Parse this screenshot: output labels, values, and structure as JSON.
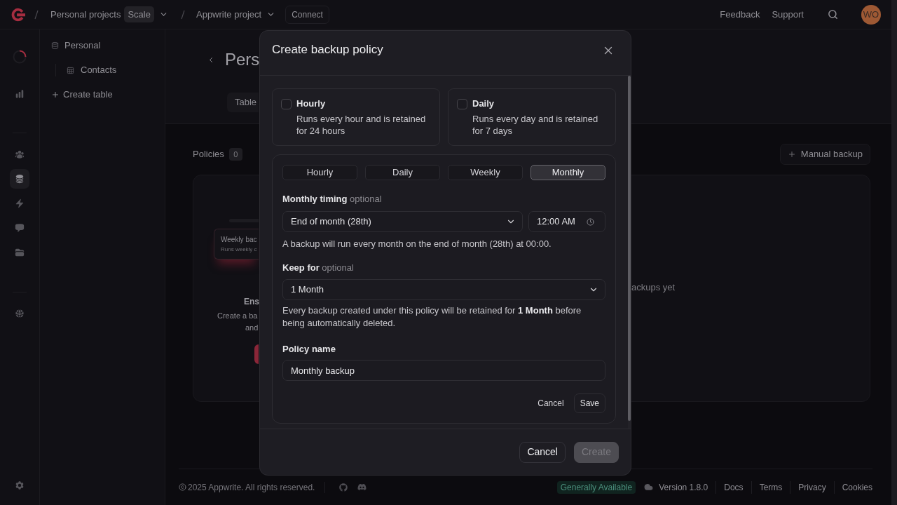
{
  "top_bar": {
    "breadcrumbs": [
      {
        "label": "Personal projects",
        "badge": "Scale"
      },
      {
        "label": "Appwrite project"
      }
    ],
    "connect_button": "Connect",
    "links": [
      "Feedback",
      "Support"
    ],
    "avatar_initials": "WO"
  },
  "nav_rail": {
    "items": [
      {
        "selected": false
      },
      {
        "selected": false
      },
      {
        "selected": true
      },
      {
        "selected": false
      },
      {
        "selected": false
      },
      {
        "selected": false
      },
      {
        "selected": false
      }
    ]
  },
  "database_sidebar": {
    "database": "Personal",
    "tables": [
      {
        "label": "Contacts"
      }
    ],
    "create_button": "Create table"
  },
  "page_header": {
    "title": "Pers",
    "tabs": [
      {
        "label": "Table"
      }
    ]
  },
  "backups": {
    "policies_label": "Policies",
    "policies_count": "0",
    "manual_backup_button": "Manual backup",
    "policies_empty": {
      "preview_title": "Weekly bac",
      "preview_subtitle": "Runs weekly c",
      "heading": "Ens",
      "description_lines": [
        "Create a ba",
        "and"
      ]
    },
    "backups_empty_text": "ackups yet"
  },
  "dialog": {
    "title": "Create backup policy",
    "presets": [
      {
        "title": "Hourly",
        "description": "Runs every hour and is retained for 24 hours",
        "checked": false
      },
      {
        "title": "Daily",
        "description": "Runs every day and is retained for 7 days",
        "checked": false
      }
    ],
    "custom_policy": {
      "frequencies": [
        {
          "label": "Hourly",
          "selected": false
        },
        {
          "label": "Daily",
          "selected": false
        },
        {
          "label": "Weekly",
          "selected": false
        },
        {
          "label": "Monthly",
          "selected": true
        }
      ],
      "timing_label": "Monthly timing",
      "timing_optional": "optional",
      "timing_select": "End of month (28th)",
      "time_field": "12:00 AM",
      "timing_help": "A backup will run every month on the end of month (28th) at 00:00.",
      "keep_label": "Keep for",
      "keep_optional": "optional",
      "keep_select": "1 Month",
      "keep_help": "Every backup created under this policy will be retained for **1 Month** before being automatically deleted.",
      "name_label": "Policy name",
      "name_value": "Monthly backup",
      "cancel_button": "Cancel",
      "save_button": "Save"
    },
    "buttons": [
      {
        "label": "Cancel",
        "kind": "secondary",
        "disabled": false
      },
      {
        "label": "Create",
        "kind": "primary",
        "disabled": true
      }
    ]
  },
  "footer": {
    "copyright": "2025 Appwrite. All rights reserved.",
    "status_badge": "Generally Available",
    "version": "Version 1.8.0",
    "links": [
      "Docs",
      "Terms",
      "Privacy",
      "Cookies"
    ]
  }
}
